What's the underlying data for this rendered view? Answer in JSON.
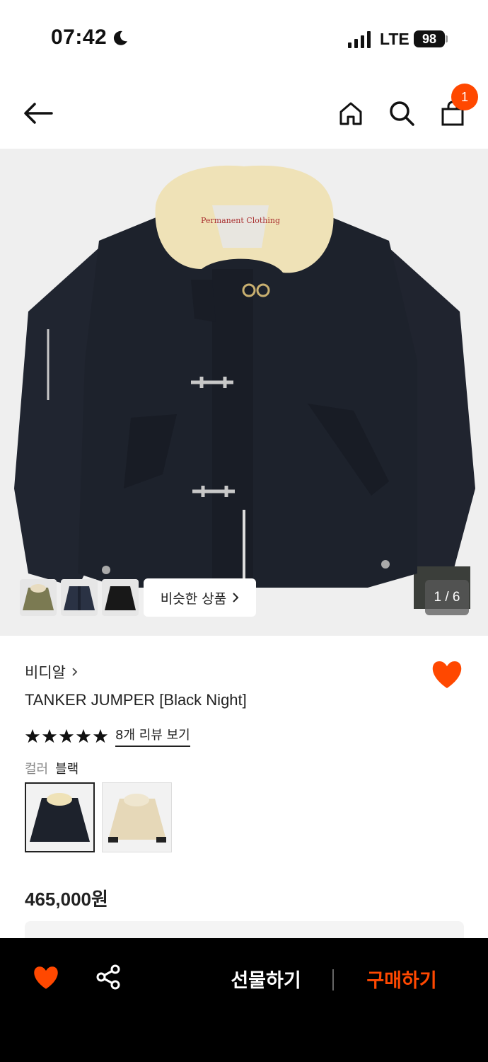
{
  "status_bar": {
    "time": "07:42",
    "network": "LTE",
    "battery": "98"
  },
  "header": {
    "cart_count": "1"
  },
  "gallery": {
    "similar_label": "비슷한 상품",
    "counter": "1 / 6"
  },
  "product": {
    "brand": "비디알",
    "title": "TANKER JUMPER [Black Night]",
    "stars": 5,
    "review_link": "8개 리뷰 보기",
    "color_label": "컬러",
    "color_value": "블랙",
    "price": "465,000원"
  },
  "bottom_bar": {
    "gift_label": "선물하기",
    "buy_label": "구매하기"
  },
  "colors": {
    "accent": "#ff4800",
    "bar": "#000000"
  }
}
